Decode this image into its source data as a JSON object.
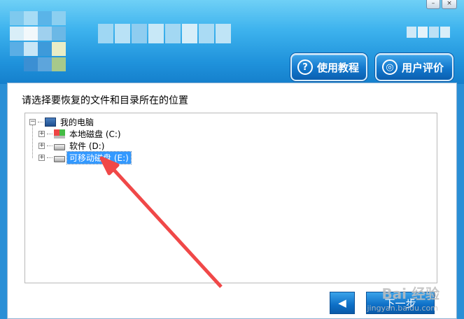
{
  "window": {
    "minimize_symbol": "–",
    "close_symbol": "×"
  },
  "header": {
    "help_button": {
      "label": "使用教程",
      "icon": "question-icon",
      "icon_glyph": "?"
    },
    "review_button": {
      "label": "用户评价",
      "icon": "gear-icon",
      "icon_glyph": "◎"
    }
  },
  "main": {
    "prompt": "请选择要恢复的文件和目录所在的位置",
    "tree": {
      "root": {
        "label": "我的电脑",
        "icon": "computer-icon",
        "expander": "−"
      },
      "items": [
        {
          "label": "本地磁盘 (C:)",
          "icon": "system-drive-icon",
          "expander": "+"
        },
        {
          "label": "软件 (D:)",
          "icon": "drive-icon",
          "expander": "+"
        },
        {
          "label": "可移动磁盘 (E:)",
          "icon": "removable-drive-icon",
          "expander": "+",
          "selected": true
        }
      ]
    },
    "nav": {
      "back_symbol": "◀",
      "next_label": "下一步"
    }
  },
  "watermark": {
    "brand": "Bai  经验",
    "sub": "jingyan.baidu.com"
  },
  "colors": {
    "header_top": "#6fd0f6",
    "header_bottom": "#157fcc",
    "selection": "#3399ff",
    "annotation_arrow": "#f04848"
  }
}
